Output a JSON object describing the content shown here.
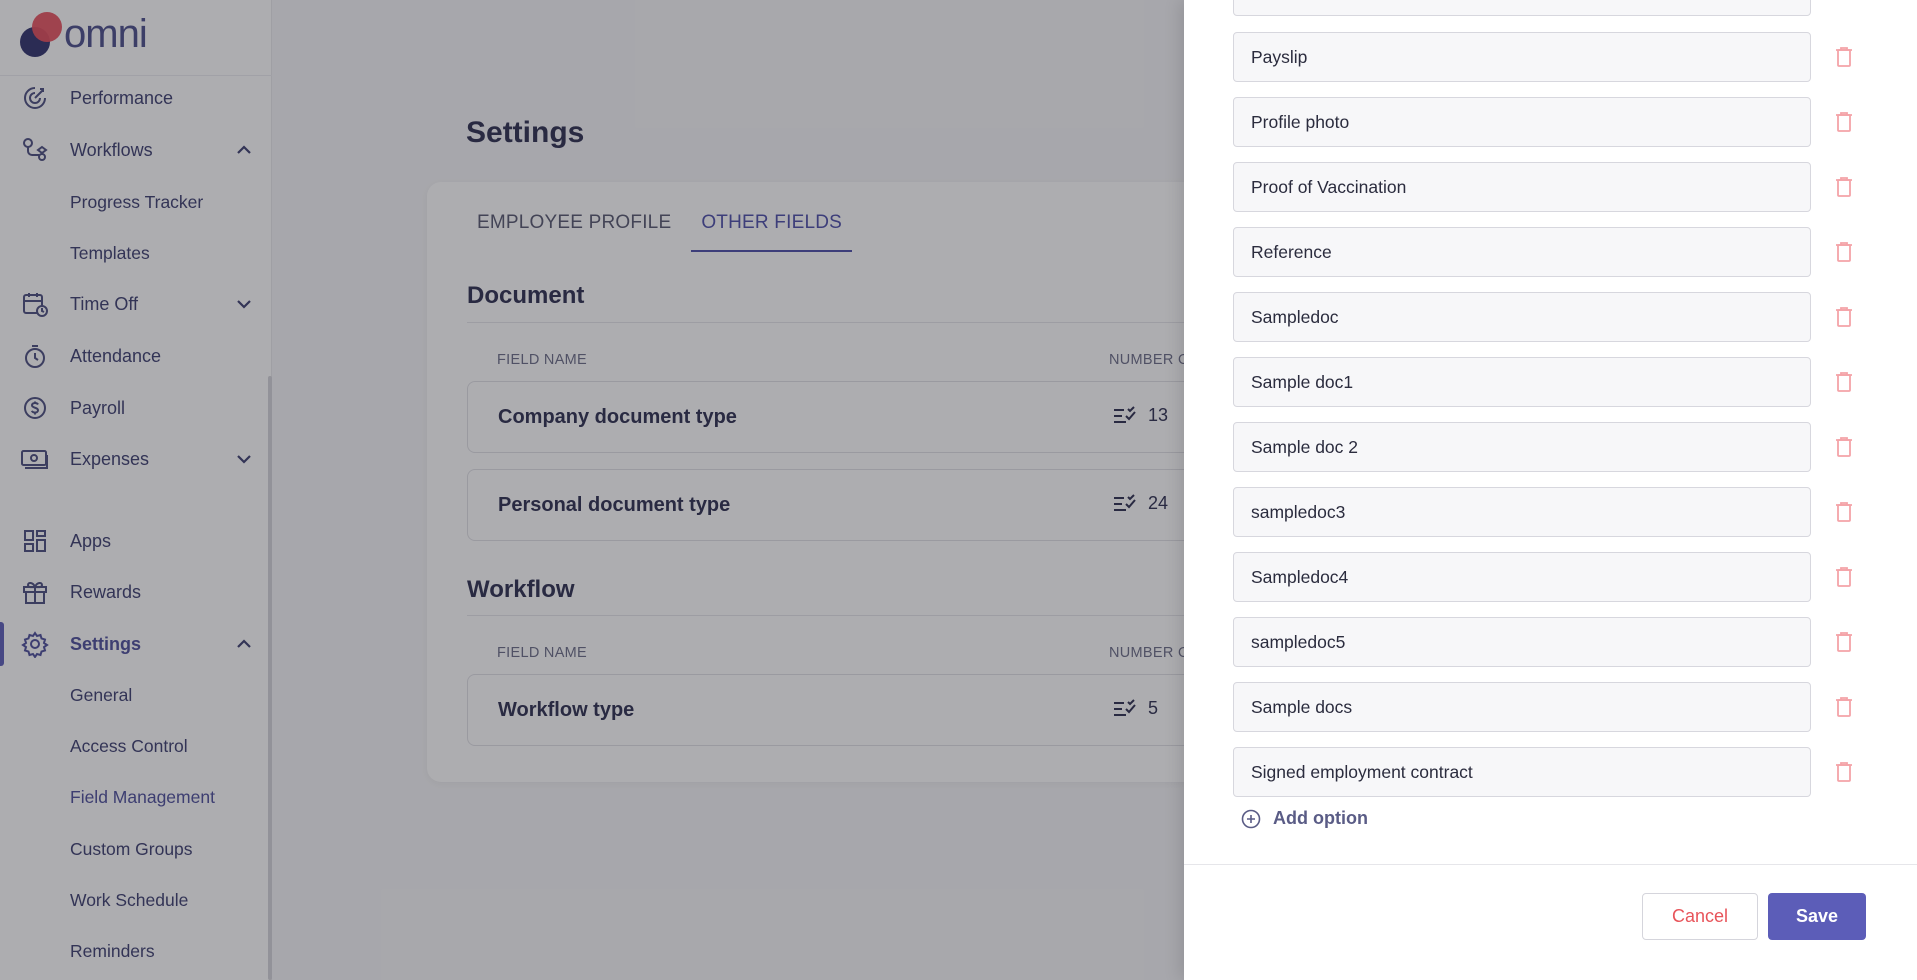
{
  "app": {
    "logo_text": "omni"
  },
  "sidebar": {
    "items": [
      {
        "label": "Performance"
      },
      {
        "label": "Workflows"
      },
      {
        "label": "Progress Tracker"
      },
      {
        "label": "Templates"
      },
      {
        "label": "Time Off"
      },
      {
        "label": "Attendance"
      },
      {
        "label": "Payroll"
      },
      {
        "label": "Expenses"
      },
      {
        "label": "Apps"
      },
      {
        "label": "Rewards"
      },
      {
        "label": "Settings"
      },
      {
        "label": "General"
      },
      {
        "label": "Access Control"
      },
      {
        "label": "Field Management"
      },
      {
        "label": "Custom Groups"
      },
      {
        "label": "Work Schedule"
      },
      {
        "label": "Reminders"
      }
    ]
  },
  "main": {
    "title": "Settings",
    "tabs": [
      {
        "label": "EMPLOYEE PROFILE"
      },
      {
        "label": "OTHER FIELDS"
      }
    ],
    "sections": [
      {
        "title": "Document",
        "col_field_name": "FIELD NAME",
        "col_number": "NUMBER O",
        "rows": [
          {
            "name": "Company document type",
            "count": "13"
          },
          {
            "name": "Personal document type",
            "count": "24"
          }
        ]
      },
      {
        "title": "Workflow",
        "col_field_name": "FIELD NAME",
        "col_number": "NUMBER O",
        "rows": [
          {
            "name": "Workflow type",
            "count": "5"
          }
        ]
      }
    ]
  },
  "drawer": {
    "options": [
      "Payslip",
      "Profile photo",
      "Proof of Vaccination",
      "Reference",
      "Sampledoc",
      "Sample doc1",
      "Sample doc 2",
      "sampledoc3",
      "Sampledoc4",
      "sampledoc5",
      "Sample docs",
      "Signed employment contract"
    ],
    "add_option_label": "Add option",
    "cancel_label": "Cancel",
    "save_label": "Save"
  },
  "colors": {
    "accent": "#5c5db8",
    "danger": "#e8545a",
    "delete_icon": "#f4a3a8"
  }
}
